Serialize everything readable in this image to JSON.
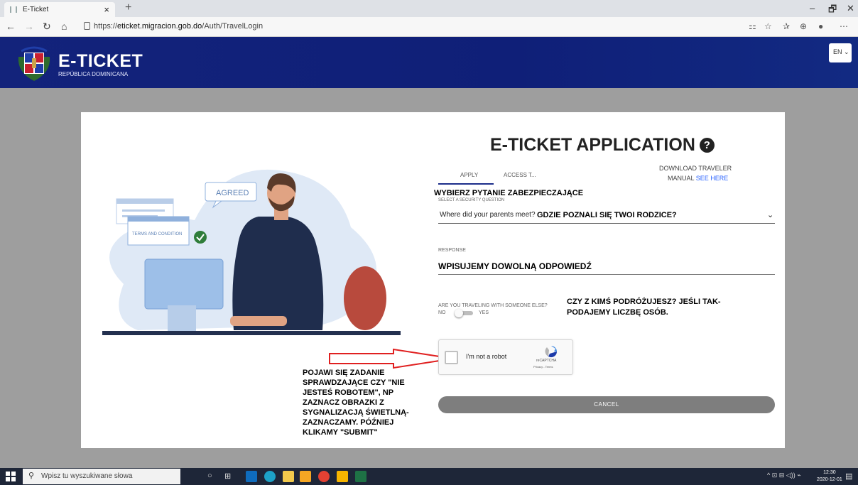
{
  "browser": {
    "tab_title": "E-Ticket",
    "tab_close": "×",
    "new_tab": "+",
    "url_prefix": "https://",
    "url_domain": "eticket.migracion.gob.do",
    "url_path": "/Auth/TravelLogin"
  },
  "header": {
    "brand": "E-TICKET",
    "brand_sub": "REPÚBLICA DOMINICANA",
    "language": "EN"
  },
  "form": {
    "title": "E-TICKET APPLICATION",
    "help_icon": "?",
    "tabs": [
      {
        "label": "APPLY"
      },
      {
        "label": "ACCESS T..."
      }
    ],
    "manual_line1": "DOWNLOAD TRAVELER",
    "manual_line2": "MANUAL",
    "manual_link": "SEE HERE",
    "security_label": "SELECT A SECURITY QUESTION",
    "security_value": "Where did your parents meet?",
    "response_label": "RESPONSE",
    "travel_label": "ARE YOU TRAVELING WITH SOMEONE ELSE?",
    "toggle_no": "NO",
    "toggle_yes": "YES",
    "captcha_text": "I'm not a robot",
    "captcha_brand": "reCAPTCHA",
    "captcha_privacy": "Privacy - Terms",
    "cancel": "CANCEL"
  },
  "illustration": {
    "bubble": "AGREED",
    "terms": "TERMS AND CONDITION"
  },
  "annotations": {
    "security_note": "WYBIERZ PYTANIE ZABEZPIECZAJĄCE",
    "security_answer_note": "GDZIE POZNALI SIĘ TWOI RODZICE?",
    "response_note": "WPISUJEMY DOWOLNĄ ODPOWIEDŹ",
    "travel_note_1": "CZY Z KIMŚ PODRÓŻUJESZ? JEŚLI TAK-",
    "travel_note_2": "PODAJEMY LICZBĘ OSÓB.",
    "captcha_note": [
      "POJAWI SIĘ ZADANIE",
      "SPRAWDZAJĄCE CZY \"NIE",
      "JESTEŚ ROBOTEM\", NP",
      "ZAZNACZ OBRAZKI Z",
      "SYGNALIZACJĄ ŚWIETLNĄ-",
      "ZAZNACZAMY. PÓŹNIEJ",
      "KLIKAMY \"SUBMIT\""
    ]
  },
  "taskbar": {
    "search_placeholder": "Wpisz tu wyszukiwane słowa",
    "time": "12:30",
    "date": "2020-12-01"
  }
}
